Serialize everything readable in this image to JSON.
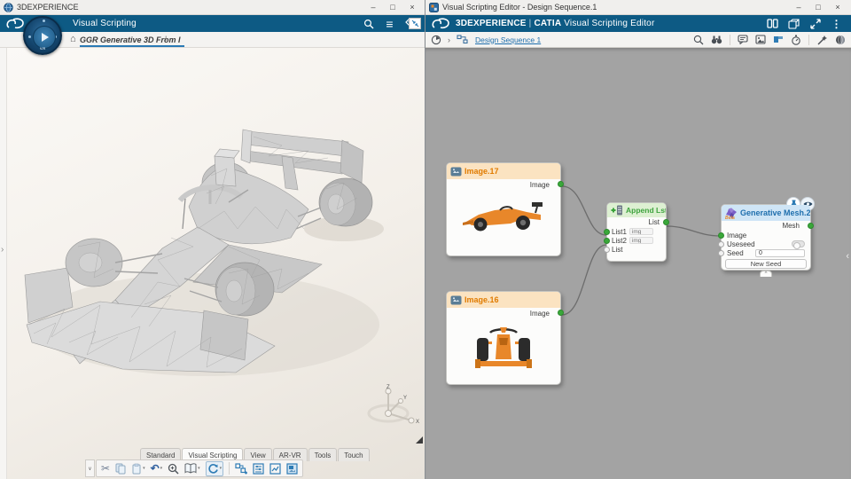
{
  "window_controls": {
    "minimize": "–",
    "maximize": "□",
    "close": "×"
  },
  "glyphs": {
    "chevron_right": "›",
    "chevron_left": "‹",
    "breadcrumb_chevron": "›",
    "home": "⌂",
    "hamburger": "≡",
    "kebab": "⋮",
    "caret_down": "▾",
    "cut": "✂",
    "undo": "↶",
    "overflow": "∨",
    "collapse_up": "^",
    "tab_plus": "+"
  },
  "left_window": {
    "titlebar": {
      "title": "3DEXPERIENCE"
    },
    "app_bar": {
      "title": "Visual Scripting"
    },
    "compass": {
      "label": "V.R"
    },
    "doc_tab": {
      "label": "GGR Generative 3D From I"
    },
    "bottom_tabs": [
      {
        "label": "Standard"
      },
      {
        "label": "Visual Scripting"
      },
      {
        "label": "View"
      },
      {
        "label": "AR-VR"
      },
      {
        "label": "Tools"
      },
      {
        "label": "Touch"
      }
    ],
    "axis": {
      "x": "X",
      "y": "Y",
      "z": "Z"
    }
  },
  "right_window": {
    "titlebar": {
      "title": "Visual Scripting Editor - Design Sequence.1"
    },
    "app_bar": {
      "brand": "3DEXPERIENCE",
      "divider": "|",
      "product": "CATIA",
      "suffix": "Visual Scripting Editor"
    },
    "breadcrumb": {
      "doc_link": "Design Sequence 1"
    },
    "canvas": {
      "nodes": {
        "image17": {
          "title": "Image.17",
          "output_port": "Image"
        },
        "image16": {
          "title": "Image.16",
          "output_port": "Image"
        },
        "append": {
          "title": "Append Lsts",
          "output_port": "List",
          "input1": "List1",
          "input2": "List2",
          "input3": "List",
          "placeholder1": "img",
          "placeholder2": "img"
        },
        "genmesh": {
          "title": "Generative Mesh.2",
          "beta": "Beta",
          "output_port": "Mesh",
          "input_image": "Image",
          "input_useseed": "Useseed",
          "input_seed": "Seed",
          "seed_value": "0",
          "new_seed_button": "New Seed"
        }
      }
    }
  },
  "colors": {
    "brand_blue": "#0d5a84",
    "node_image_accent": "#e07b00",
    "node_append_accent": "#3fa33f",
    "node_mesh_accent": "#1f6fad",
    "port_green": "#3aa83a",
    "canvas_gray": "#a3a3a3"
  }
}
